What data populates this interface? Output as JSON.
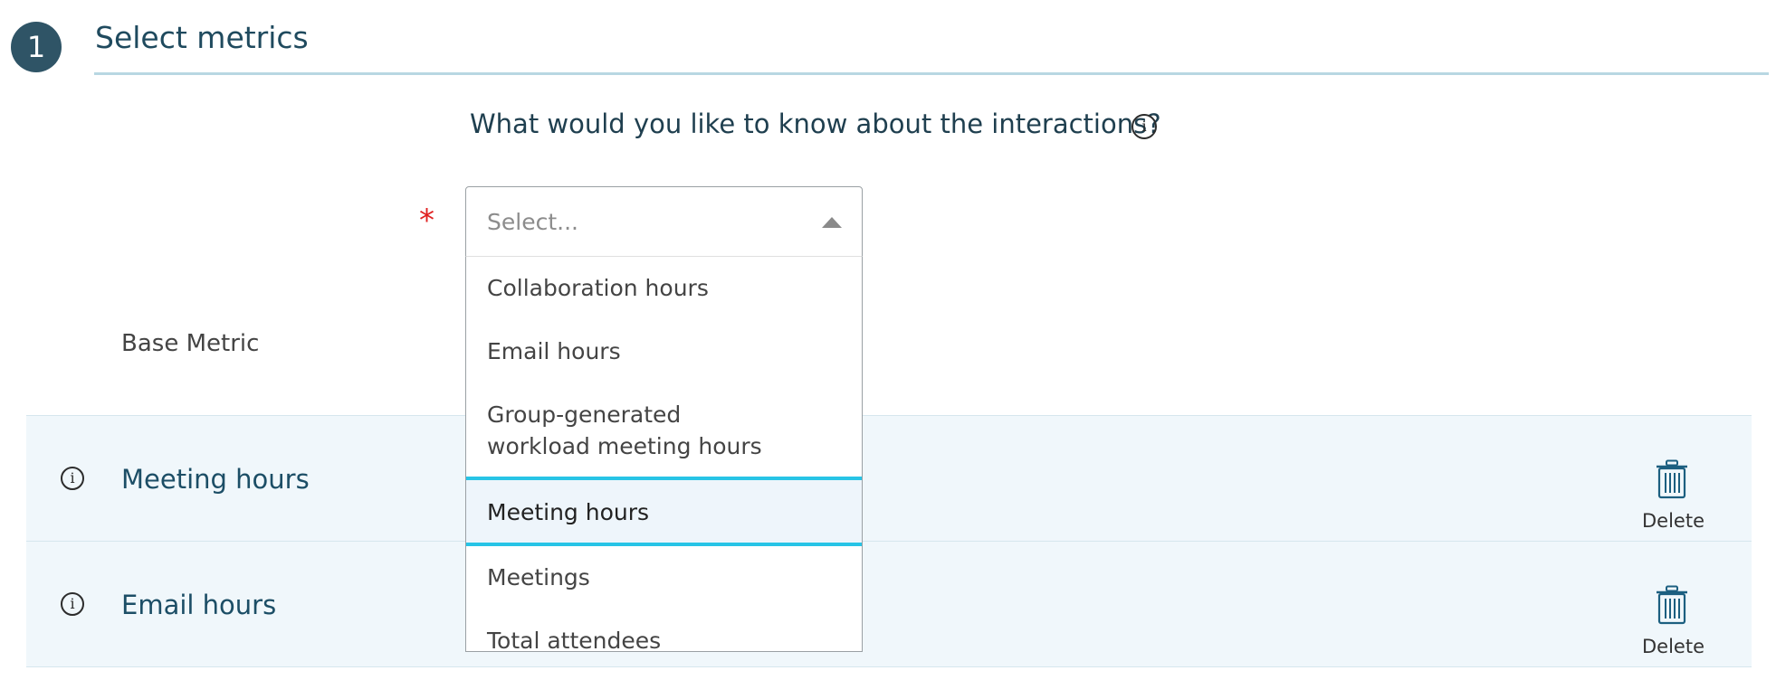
{
  "step": {
    "number": "1",
    "title": "Select metrics"
  },
  "question": {
    "text": "What would you like to know about the interactions?",
    "info_icon": "info-circle-icon",
    "required_marker": "*"
  },
  "select": {
    "placeholder": "Select...",
    "expanded": true,
    "options": [
      "Collaboration hours",
      "Email hours",
      "Group-generated workload meeting hours",
      "Meeting hours",
      "Meetings",
      "Total attendees"
    ],
    "highlighted_option": "Meeting hours"
  },
  "base_metric_label": "Base Metric",
  "metrics": [
    {
      "label": "Meeting hours",
      "delete_label": "Delete"
    },
    {
      "label": "Email hours",
      "delete_label": "Delete"
    }
  ],
  "colors": {
    "step_circle": "#2f5466",
    "title_text": "#1f4a5e",
    "required": "#e02020",
    "row_background": "#f0f7fb",
    "highlight_border": "#27c4e6"
  }
}
